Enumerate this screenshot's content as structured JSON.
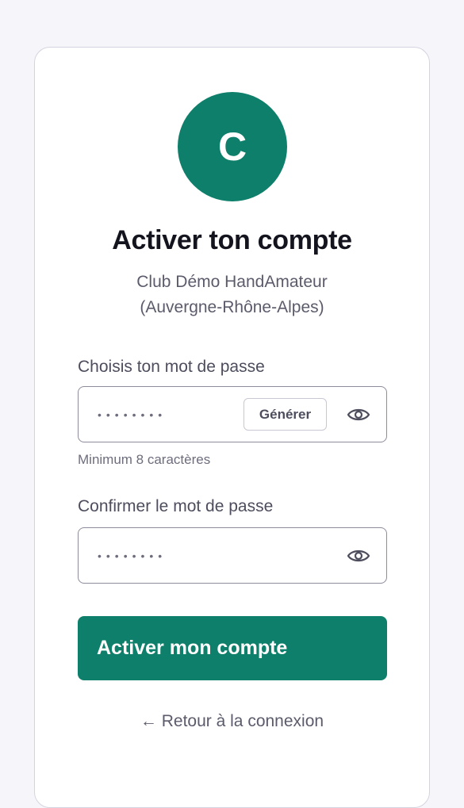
{
  "avatar": {
    "letter": "C"
  },
  "title": "Activer ton compte",
  "subtitle": {
    "line1": "Club Démo HandAmateur",
    "line2": "(Auvergne-Rhône-Alpes)"
  },
  "password": {
    "label": "Choisis ton mot de passe",
    "masked_value": "••••••••",
    "generate_label": "Générer",
    "hint": "Minimum 8 caractères",
    "toggle_icon": "eye-icon"
  },
  "confirm": {
    "label": "Confirmer le mot de passe",
    "masked_value": "••••••••",
    "toggle_icon": "eye-icon"
  },
  "submit_label": "Activer mon compte",
  "back_link": "← Retour à la connexion",
  "colors": {
    "brand": "#0e7f6a",
    "background": "#f6f6fa",
    "card": "#ffffff"
  }
}
